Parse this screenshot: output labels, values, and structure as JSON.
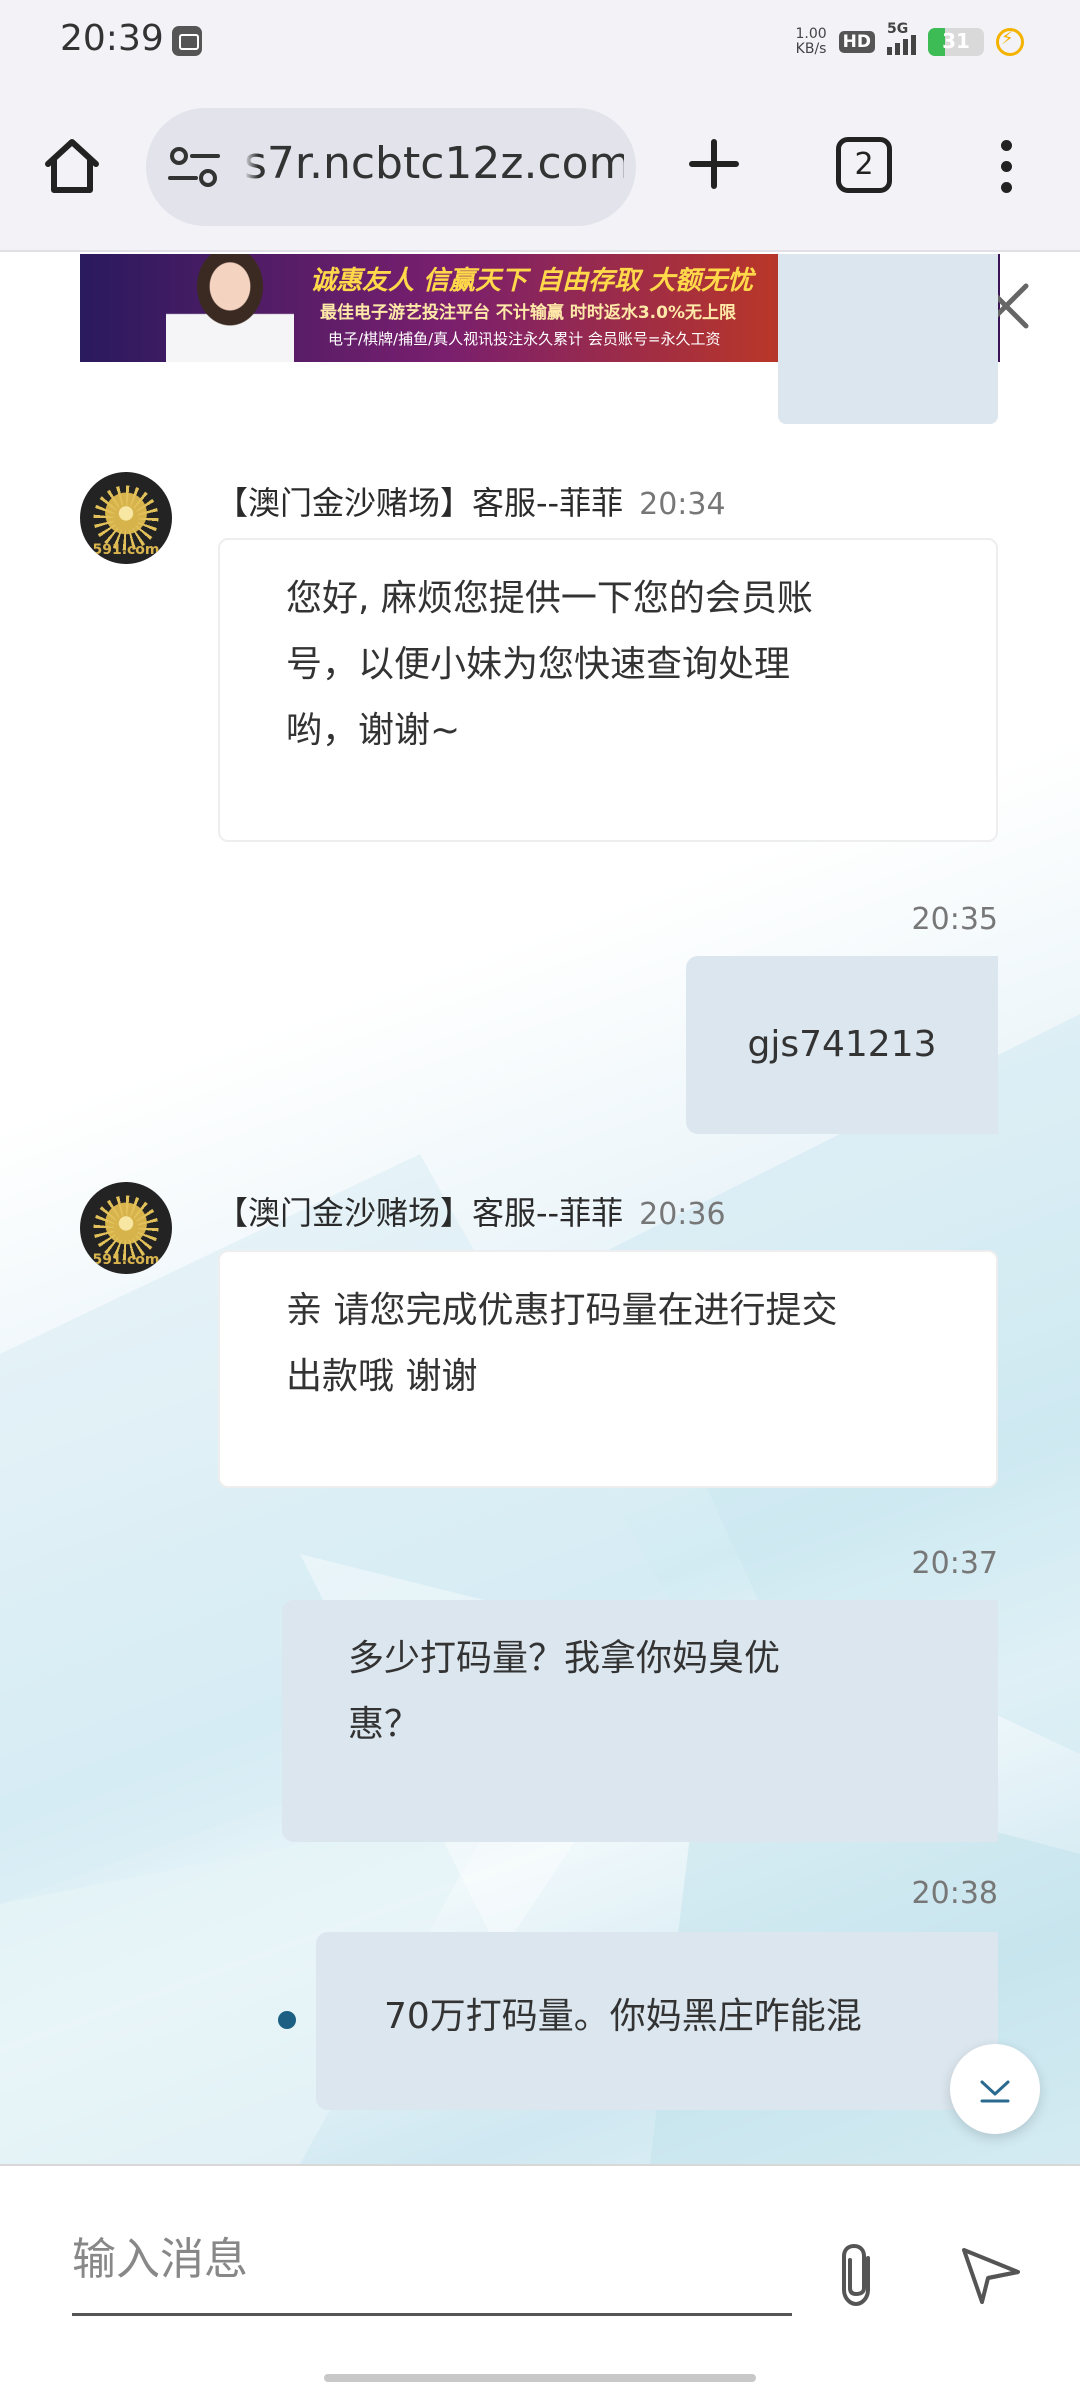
{
  "status_bar": {
    "time": "20:39",
    "net_speed_value": "1.00",
    "net_speed_unit": "KB/s",
    "hd_badge": "HD",
    "network": "5G",
    "battery_level": "31",
    "battery_fraction": 0.31
  },
  "browser": {
    "url": "s7r.ncbtc12z.com",
    "tab_count": "2"
  },
  "ad_banner": {
    "headline": "诚惠友人 信赢天下 自由存取 大额无忧",
    "subline": "最佳电子游艺投注平台 不计输赢 时时返水3.0%无上限",
    "footer": "电子/棋牌/捕鱼/真人视讯投注永久累计 会员账号=永久工资"
  },
  "chat": {
    "messages": [
      {
        "direction": "in",
        "sender": "【澳门金沙赌场】客服--菲菲",
        "time": "20:34",
        "text_lines": [
          "您好, 麻烦您提供一下您的会员账",
          "号，以便小妹为您快速查询处理",
          "哟，谢谢~"
        ]
      },
      {
        "direction": "out",
        "time": "20:35",
        "text": "gjs741213"
      },
      {
        "direction": "in",
        "sender": "【澳门金沙赌场】客服--菲菲",
        "time": "20:36",
        "text_lines": [
          "亲 请您完成优惠打码量在进行提交",
          "出款哦 谢谢"
        ]
      },
      {
        "direction": "out",
        "time": "20:37",
        "text_lines": [
          "多少打码量？我拿你妈臭优",
          "惠？"
        ]
      },
      {
        "direction": "out",
        "time": "20:38",
        "text": "70万打码量。你妈黑庄咋能混"
      }
    ],
    "avatar_text": "591.com"
  },
  "composer": {
    "placeholder": "输入消息"
  },
  "icons": {
    "home": "home-icon",
    "site_settings": "tune-icon",
    "new_tab": "plus-icon",
    "menu": "more-vert-icon",
    "close": "close-icon",
    "scroll_down": "chevron-down-icon",
    "attach": "paperclip-icon",
    "send": "send-icon"
  }
}
